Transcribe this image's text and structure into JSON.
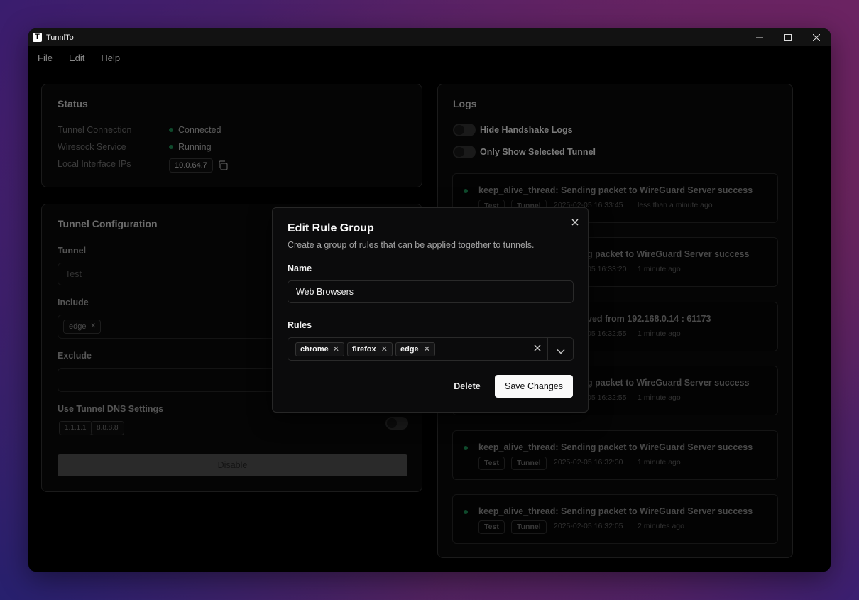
{
  "app": {
    "title": "TunnlTo",
    "logo_letter": "T"
  },
  "menu": [
    "File",
    "Edit",
    "Help"
  ],
  "status": {
    "title": "Status",
    "rows": [
      {
        "label": "Tunnel Connection",
        "value": "Connected"
      },
      {
        "label": "Wiresock Service",
        "value": "Running"
      },
      {
        "label": "Local Interface IPs",
        "value": "10.0.64.7"
      }
    ]
  },
  "tunnel_config": {
    "title": "Tunnel Configuration",
    "tunnel_label": "Tunnel",
    "tunnel_value": "Test",
    "include_label": "Include",
    "include_tags": [
      "edge"
    ],
    "exclude_label": "Exclude",
    "dns_label": "Use Tunnel DNS Settings",
    "dns_servers": [
      "1.1.1.1",
      "8.8.8.8"
    ],
    "disable_label": "Disable"
  },
  "logs": {
    "title": "Logs",
    "toggle_handshake": "Hide Handshake Logs",
    "toggle_selected": "Only Show Selected Tunnel",
    "entries": [
      {
        "message": "keep_alive_thread: Sending packet to WireGuard Server success",
        "tags": [
          "Test",
          "Tunnel"
        ],
        "timestamp": "2025-02-05  16:33:45",
        "ago": "less than a minute ago"
      },
      {
        "message": "g packet to WireGuard Server success",
        "tags": [],
        "timestamp": "05  16:33:20",
        "ago": "1 minute ago"
      },
      {
        "message": "ved from 192.168.0.14 : 61173",
        "tags": [],
        "timestamp": "05  16:32:55",
        "ago": "1 minute ago"
      },
      {
        "message": "g packet to WireGuard Server success",
        "tags": [],
        "timestamp": "05  16:32:55",
        "ago": "1 minute ago"
      },
      {
        "message": "keep_alive_thread: Sending packet to WireGuard Server success",
        "tags": [
          "Test",
          "Tunnel"
        ],
        "timestamp": "2025-02-05  16:32:30",
        "ago": "1 minute ago"
      },
      {
        "message": "keep_alive_thread: Sending packet to WireGuard Server success",
        "tags": [
          "Test",
          "Tunnel"
        ],
        "timestamp": "2025-02-05  16:32:05",
        "ago": "2 minutes ago"
      }
    ]
  },
  "modal": {
    "title": "Edit Rule Group",
    "description": "Create a group of rules that can be applied together to tunnels.",
    "name_label": "Name",
    "name_value": "Web Browsers",
    "rules_label": "Rules",
    "rules": [
      "chrome",
      "firefox",
      "edge"
    ],
    "delete_label": "Delete",
    "save_label": "Save Changes"
  },
  "colors": {
    "status_green": "#22c55e",
    "accent_white": "#fafafa"
  }
}
